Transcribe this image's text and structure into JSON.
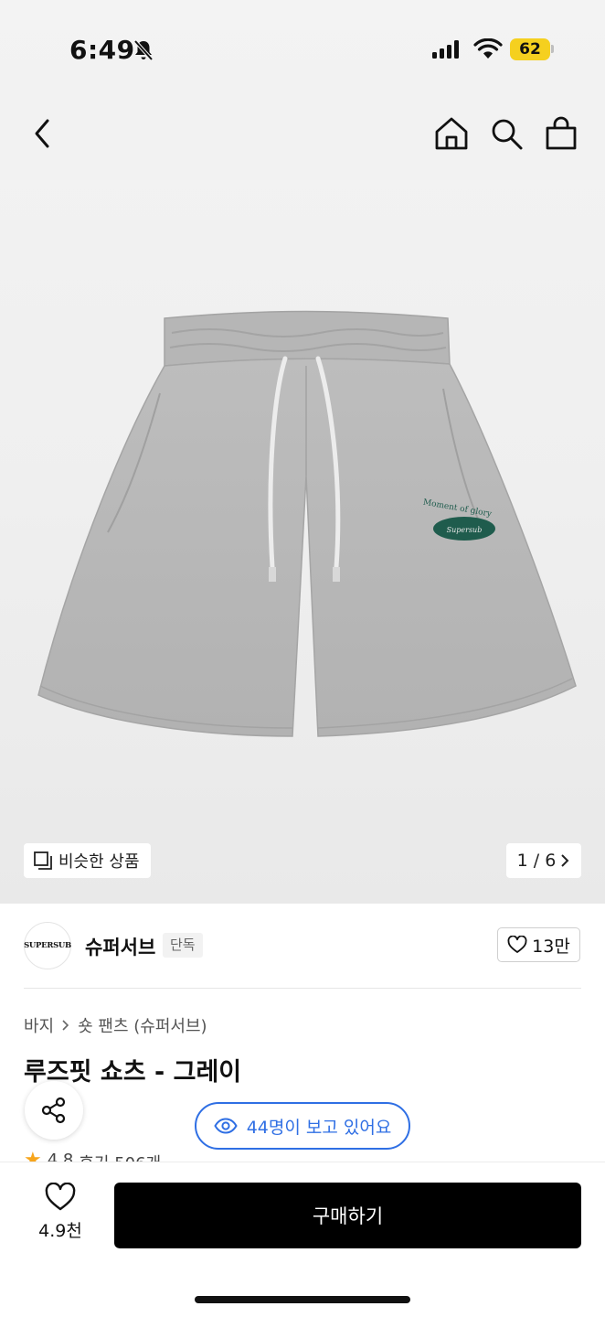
{
  "status_bar": {
    "time": "6:49",
    "battery": "62"
  },
  "gallery": {
    "similar_label": "비슷한 상품",
    "page_indicator": "1 / 6",
    "logo_text": "Moment of glory",
    "logo_script": "Supersub"
  },
  "brand": {
    "logo_text": "SUPERSUB",
    "name": "슈퍼서브",
    "badge": "단독",
    "like_count": "13만"
  },
  "product": {
    "breadcrumb": [
      "바지",
      "숏 팬츠 (슈퍼서브)"
    ],
    "title": "루즈핏 쇼츠 - 그레이",
    "rating": "4.8",
    "reviews": "후기 506개",
    "viewers": "44명이 보고 있어요"
  },
  "bottom_bar": {
    "wish_count": "4.9천",
    "buy_label": "구매하기"
  },
  "colors": {
    "accent_blue": "#2f6fe4",
    "star": "#f7a51c",
    "battery": "#f5d01f"
  }
}
